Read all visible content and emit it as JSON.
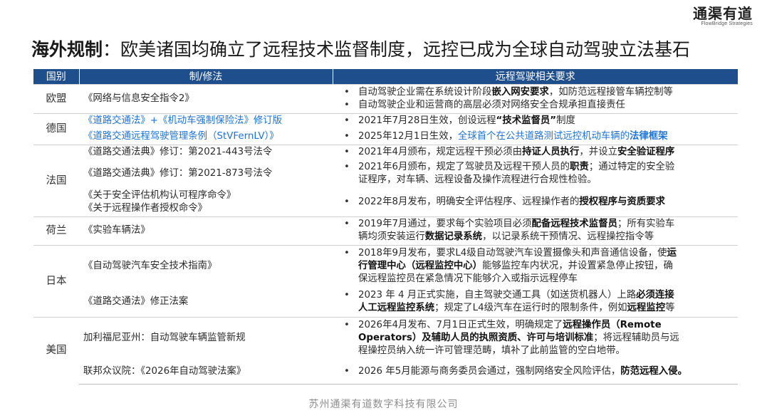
{
  "logo": {
    "name": "通渠有道",
    "sub": "FlowBridge Strategies"
  },
  "title": {
    "lead": "海外规制",
    "rest": "：欧美诸国均确立了远程技术监督制度，远控已成为全球自动驾驶立法基石"
  },
  "table": {
    "headers": [
      "国别",
      "制/修法",
      "远程驾驶相关要求"
    ],
    "eu": {
      "country": "欧盟",
      "law": "《网络与信息安全指令2》",
      "req": [
        [
          "自动驾驶企业需在系统设计阶段",
          "嵌入网安要求",
          "，如防范远程接管车辆控制等"
        ],
        [
          "自动驾驶企业和运营商的高层必须对网络安全合规承担直接责任"
        ]
      ]
    },
    "de": {
      "country": "德国",
      "law1": "《道路交通法》+《机动车强制保险法》修订版",
      "req1": [
        "2021年7月28日生效，创设远程",
        "“技术监督员”",
        "制度"
      ],
      "law2": "《道路交通远程驾驶管理条例（StVFernLV）》",
      "req2": [
        "2025年12月1日生效，",
        "全球首个在公共道路测试远控机动车辆的",
        "法律框架"
      ]
    },
    "fr": {
      "country": "法国",
      "law1": "《道路交通法典》修订：第2021-443号法令",
      "req1": [
        "2021年4月颁布，规定远程干预必须由",
        "持证人员执行",
        "，并设立",
        "安全验证程序"
      ],
      "law2": "《道路交通法典》修订：第2021-873号法令",
      "req2a": [
        "2021年6月颁布，规定了驾驶员及远程干预人员的",
        "职责",
        "；通过特定的安全验"
      ],
      "req2b": "证程序，对车辆、远程设备及操作流程进行合规性检验。",
      "law3a": "《关于安全评估机构认可程序命令》",
      "law3b": "《关于远程操作者授权命令》",
      "req3": [
        "2022年8月发布，明确安全评估程序、远程操作者的",
        "授权程序与资质要求"
      ]
    },
    "nl": {
      "country": "荷兰",
      "law": "《实验车辆法》",
      "req_a": [
        "2019年7月通过，要求每个实验项目必须",
        "配备远程技术监督员",
        "；所有实验车"
      ],
      "req_b": [
        "辆均须安装运行",
        "数据记录系统",
        "，以记录系统干预情况、远程操控指令等"
      ]
    },
    "jp": {
      "country": "日本",
      "law1": "《自动驾驶汽车安全技术指南》",
      "req1_a": [
        "2018年9月发布，要求L4级自动驾驶汽车设置摄像头和声音通信设备，使",
        "运"
      ],
      "req1_b": [
        "行管理中心（远程监控中心）",
        "能够监控车内状况，并设置紧急停止按钮，确"
      ],
      "req1_c": "保远程监控员在紧急情况下能够介入或指示远程停车",
      "law2": "《道路交通法》修正法案",
      "req2_a": [
        "2023 年 4 月正式实施，自主驾驶交通工具（如送货机器人）上路",
        "必须连接"
      ],
      "req2_b": [
        "人工远程监控系统",
        "；规定了L4级汽车在运行时的限制条件，例如",
        "远程监控",
        "等"
      ]
    },
    "us": {
      "country": "美国",
      "law1": "加利福尼亚州：自动驾驶车辆监管新规",
      "req1_a": [
        "2026年4月发布、7月1日正式生效，明确规定了",
        "远程操作员（Remote"
      ],
      "req1_b": [
        "Operators）及辅助人员的执照资质、许可与培训标准",
        "；将远程辅助员与远"
      ],
      "req1_c": "程操控员纳入统一许可管理范畴，填补了此前监管的空白地带。",
      "law2": "联邦众议院：《2026年自动驾驶法案》",
      "req2": [
        "2026 年5月能源与商务委员会通过，强制网络安全风险评估，",
        "防范远程入侵。"
      ]
    }
  },
  "footer": "苏州通渠有道数字科技有限公司"
}
